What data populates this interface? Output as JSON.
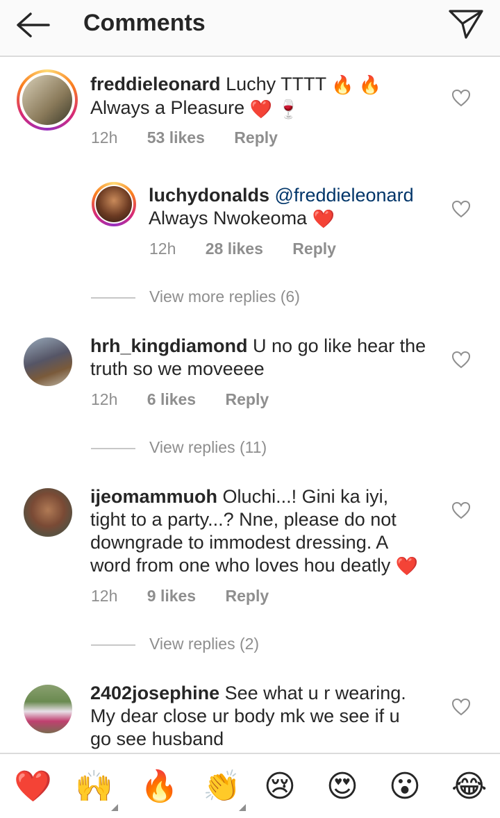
{
  "header": {
    "title": "Comments"
  },
  "comments": [
    {
      "username": "freddieleonard",
      "text1": "Luchy TTTT",
      "emoji1": "🔥 🔥",
      "text2": "Always a Pleasure",
      "emoji2": "❤️ 🍷",
      "time": "12h",
      "likes": "53 likes",
      "reply": "Reply"
    },
    {
      "username": "luchydonalds",
      "mention": "@freddieleonard",
      "text2": "Always Nwokeoma",
      "emoji2": "❤️",
      "time": "12h",
      "likes": "28 likes",
      "reply": "Reply",
      "view_more": "View more replies (6)"
    },
    {
      "username": "hrh_kingdiamond",
      "text1": "U no go like hear the",
      "text2": "truth so we moveeee",
      "time": "12h",
      "likes": "6 likes",
      "reply": "Reply",
      "view_more": "View replies (11)"
    },
    {
      "username": "ijeomammuoh",
      "text1": "Oluchi...! Gini ka iyi,",
      "text2": "tight to a party...? Nne, please do not",
      "text3": "downgrade to immodest dressing. A",
      "text4": "word from one who loves hou deatly",
      "emoji4": "❤️",
      "time": "12h",
      "likes": "9 likes",
      "reply": "Reply",
      "view_more": "View replies (2)"
    },
    {
      "username": "2402josephine",
      "text1": "See what u r wearing.",
      "text2": "My dear close ur body mk we see if u",
      "text3": "go see husband"
    }
  ],
  "emoji_bar": [
    "❤️",
    "🙌",
    "🔥",
    "👏",
    "😢",
    "😍",
    "😮",
    "😂"
  ],
  "colors": {
    "ring_start": "#feda75",
    "ring_end": "#962fbf",
    "mention": "#003569",
    "meta": "#8e8e8e",
    "heart_red": "#ed4956"
  }
}
